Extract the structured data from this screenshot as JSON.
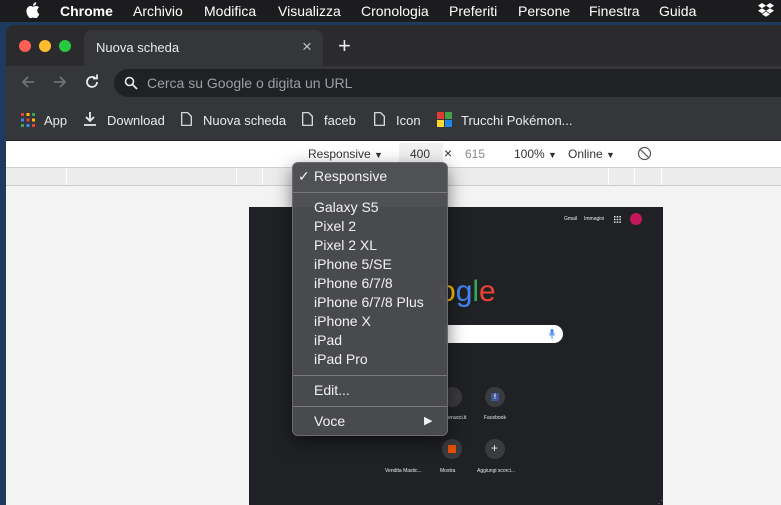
{
  "menubar": {
    "app": "Chrome",
    "items": [
      "Archivio",
      "Modifica",
      "Visualizza",
      "Cronologia",
      "Preferiti",
      "Persone",
      "Finestra",
      "Guida"
    ]
  },
  "tab": {
    "title": "Nuova scheda",
    "close": "×",
    "new": "+"
  },
  "omnibox": {
    "placeholder": "Cerca su Google o digita un URL"
  },
  "bookmarks": [
    "App",
    "Download",
    "Nuova scheda",
    "faceb",
    "Icon",
    "Trucchi Pokémon..."
  ],
  "devtools": {
    "device": "Responsive",
    "width": "400",
    "times": "×",
    "height": "615",
    "zoom": "100%",
    "network": "Online"
  },
  "google_page": {
    "gmail": "Gmail",
    "images": "Immagini",
    "logo_partial": "ogle",
    "shortcut_labels": [
      "...enucci.it",
      "Facebook",
      "Vendita Mastic...",
      "Mostra",
      "Aggiungi scorci..."
    ]
  },
  "dropdown": {
    "checkmark": "✓",
    "selected": "Responsive",
    "devices": [
      "Galaxy S5",
      "Pixel 2",
      "Pixel 2 XL",
      "iPhone 5/SE",
      "iPhone 6/7/8",
      "iPhone 6/7/8 Plus",
      "iPhone X",
      "iPad",
      "iPad Pro"
    ],
    "edit": "Edit...",
    "voice": "Voce",
    "submenu_arrow": "▶"
  }
}
